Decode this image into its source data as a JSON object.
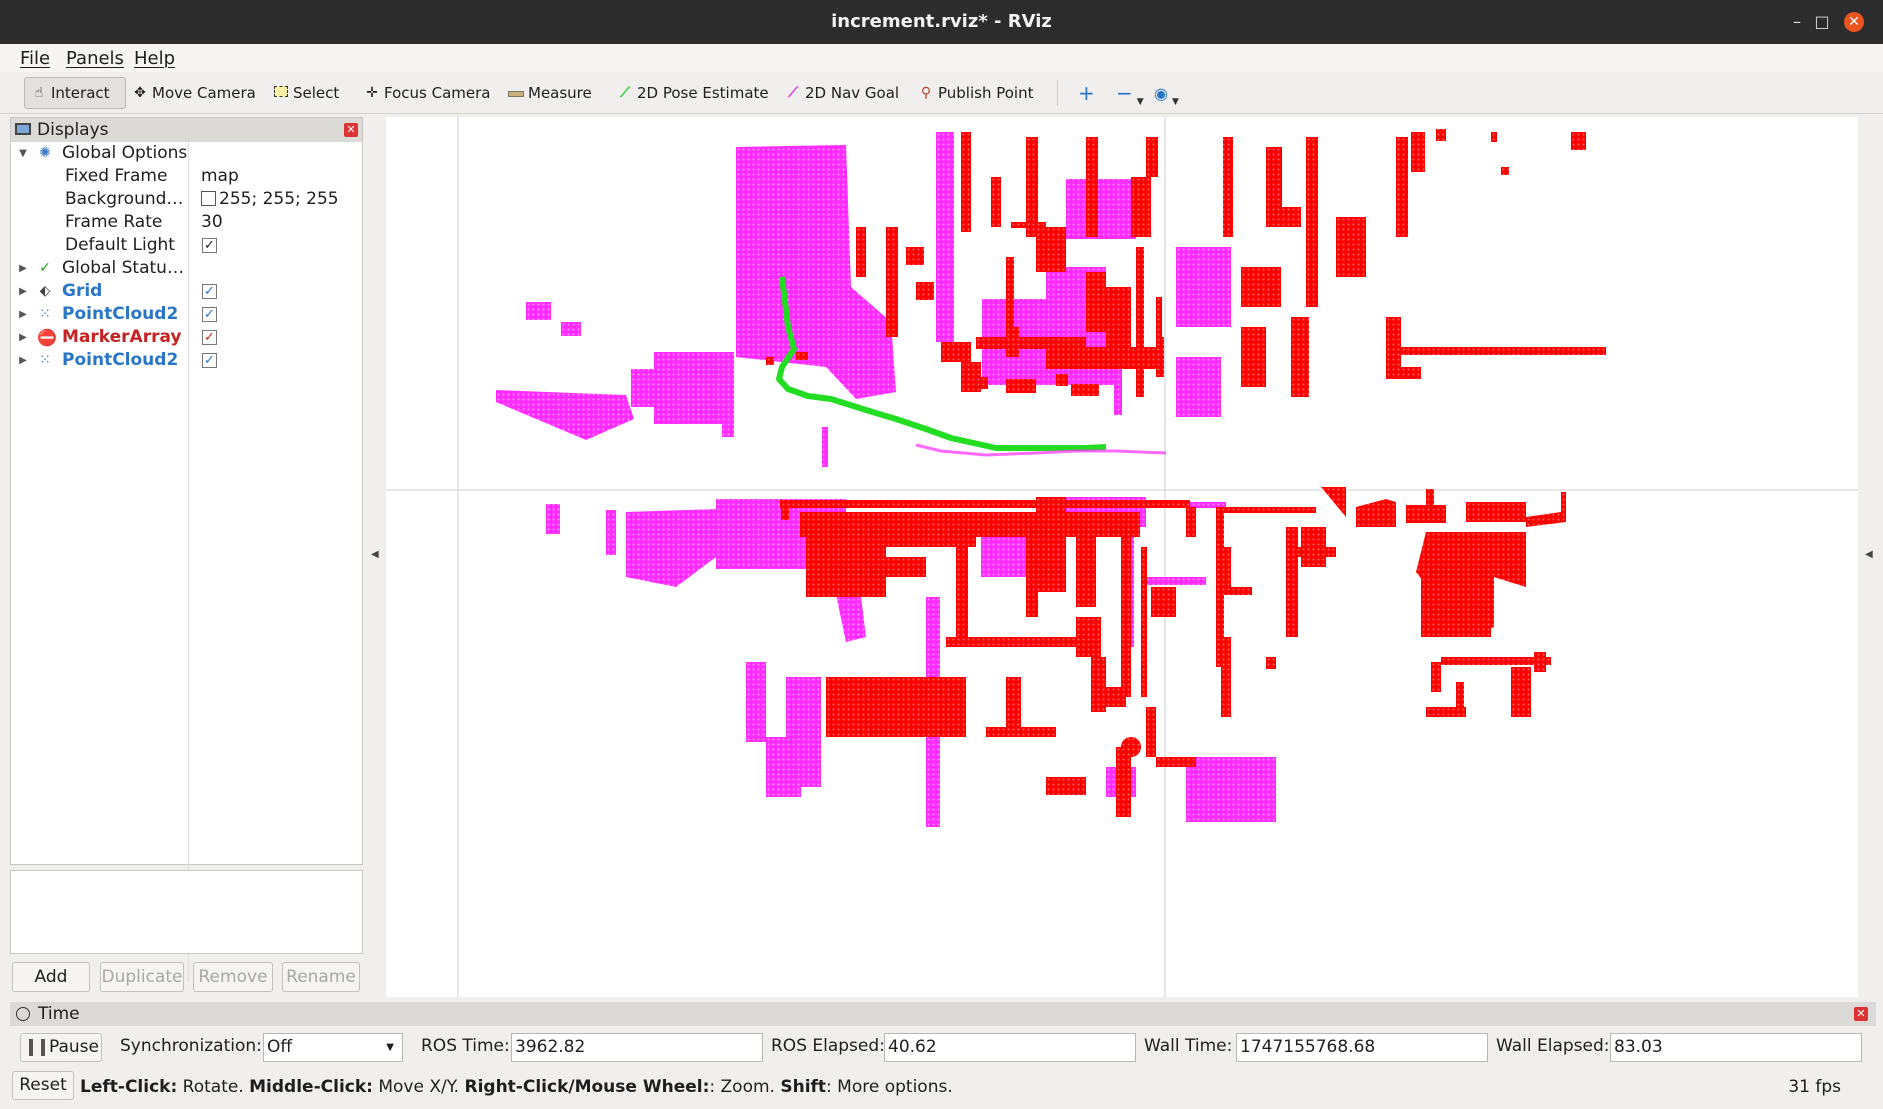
{
  "window": {
    "title": "increment.rviz* - RViz"
  },
  "menu": {
    "file": "File",
    "panels": "Panels",
    "help": "Help"
  },
  "toolbar": {
    "interact": "Interact",
    "move_camera": "Move Camera",
    "select": "Select",
    "focus_camera": "Focus Camera",
    "measure": "Measure",
    "pose_estimate": "2D Pose Estimate",
    "nav_goal": "2D Nav Goal",
    "publish_point": "Publish Point"
  },
  "displays": {
    "title": "Displays",
    "global_options": "Global Options",
    "fixed_frame_label": "Fixed Frame",
    "fixed_frame_value": "map",
    "background_label": "Background…",
    "background_value": "255; 255; 255",
    "frame_rate_label": "Frame Rate",
    "frame_rate_value": "30",
    "default_light_label": "Default Light",
    "global_status": "Global Statu…",
    "grid": "Grid",
    "pointcloud2_a": "PointCloud2",
    "marker_array": "MarkerArray",
    "pointcloud2_b": "PointCloud2",
    "check_mark": "✓"
  },
  "panel_buttons": {
    "add": "Add",
    "duplicate": "Duplicate",
    "remove": "Remove",
    "rename": "Rename"
  },
  "time": {
    "title": "Time",
    "pause": "Pause",
    "sync_label": "Synchronization:",
    "sync_value": "Off",
    "ros_time_label": "ROS Time:",
    "ros_time": "3962.82",
    "ros_elapsed_label": "ROS Elapsed:",
    "ros_elapsed": "40.62",
    "wall_time_label": "Wall Time:",
    "wall_time": "1747155768.68",
    "wall_elapsed_label": "Wall Elapsed:",
    "wall_elapsed": "83.03"
  },
  "status": {
    "reset": "Reset",
    "left_click": "Left-Click:",
    "rotate": " Rotate. ",
    "middle_click": "Middle-Click:",
    "move": " Move X/Y. ",
    "right_click": "Right-Click/Mouse Wheel:",
    "zoom": ": Zoom. ",
    "shift": "Shift",
    "more": ": More options.",
    "fps": "31 fps"
  },
  "colors": {
    "magenta": "#ff2bff",
    "red": "#ff0000",
    "green": "#22dd22",
    "grid": "#c8c8c8"
  }
}
